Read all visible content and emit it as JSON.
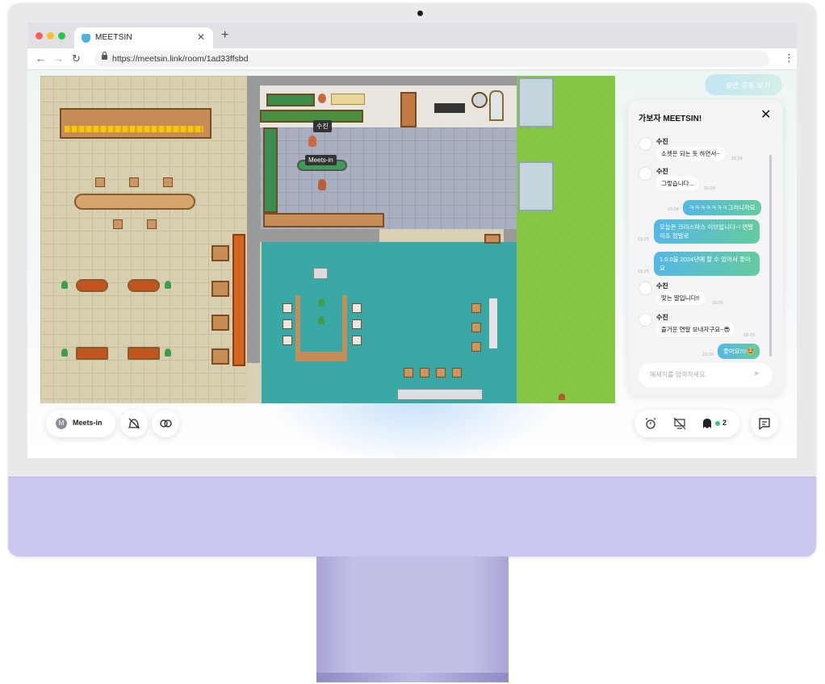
{
  "browser": {
    "tab_title": "MEETSIN",
    "new_tab_label": "+",
    "url": "https://meetsin.link/room/1ad33ffsbd"
  },
  "map": {
    "player_label": "수진",
    "npc_label": "Meets-in"
  },
  "toolbar": {
    "profile_initial": "M",
    "profile_name": "Meets-in",
    "share_screen_label": "화면 공유 보기",
    "online_count": "2"
  },
  "chat": {
    "title": "가보자 MEETSIN!",
    "input_placeholder": "메세지를 입력하세요.",
    "messages": [
      {
        "sender": "수진",
        "text": "소켓은 되는 듯 하면서~",
        "time": "15:24"
      },
      {
        "sender": "수진",
        "text": "그렇습니다...",
        "time": "15:24"
      },
      {
        "sender": "me",
        "text": "ㅋㅋㅋㅋㅋㅋㅋ그러니까요",
        "time": "15:24"
      },
      {
        "sender": "me",
        "text": "오늘은 크리스마스 이브입니다~! 연말이죠 정말로",
        "time": "15:25"
      },
      {
        "sender": "me",
        "text": "1.0.0을 2024년에 할 수 있어서 좋아요",
        "time": "15:25"
      },
      {
        "sender": "수진",
        "text": "맞는 말입니다!!",
        "time": "15:25"
      },
      {
        "sender": "수진",
        "text": "즐거운 연말 보내자구요~😎",
        "time": "15:25"
      },
      {
        "sender": "me",
        "text": "좋아요!!!!🤩",
        "time": "15:26"
      }
    ]
  },
  "colors": {
    "chat_gradient_start": "#55b7e4",
    "chat_gradient_end": "#65cba0",
    "online_dot": "#3ec27a",
    "monitor_chin": "#c9c6ef",
    "grass": "#86c645",
    "teal_floor": "#3aa8a4"
  },
  "icons": {
    "mute": "bell-off-icon",
    "link": "link-icon",
    "timer": "alarm-icon",
    "screen_share": "screen-off-icon",
    "users": "ghost-icon",
    "chat": "message-square-icon"
  }
}
